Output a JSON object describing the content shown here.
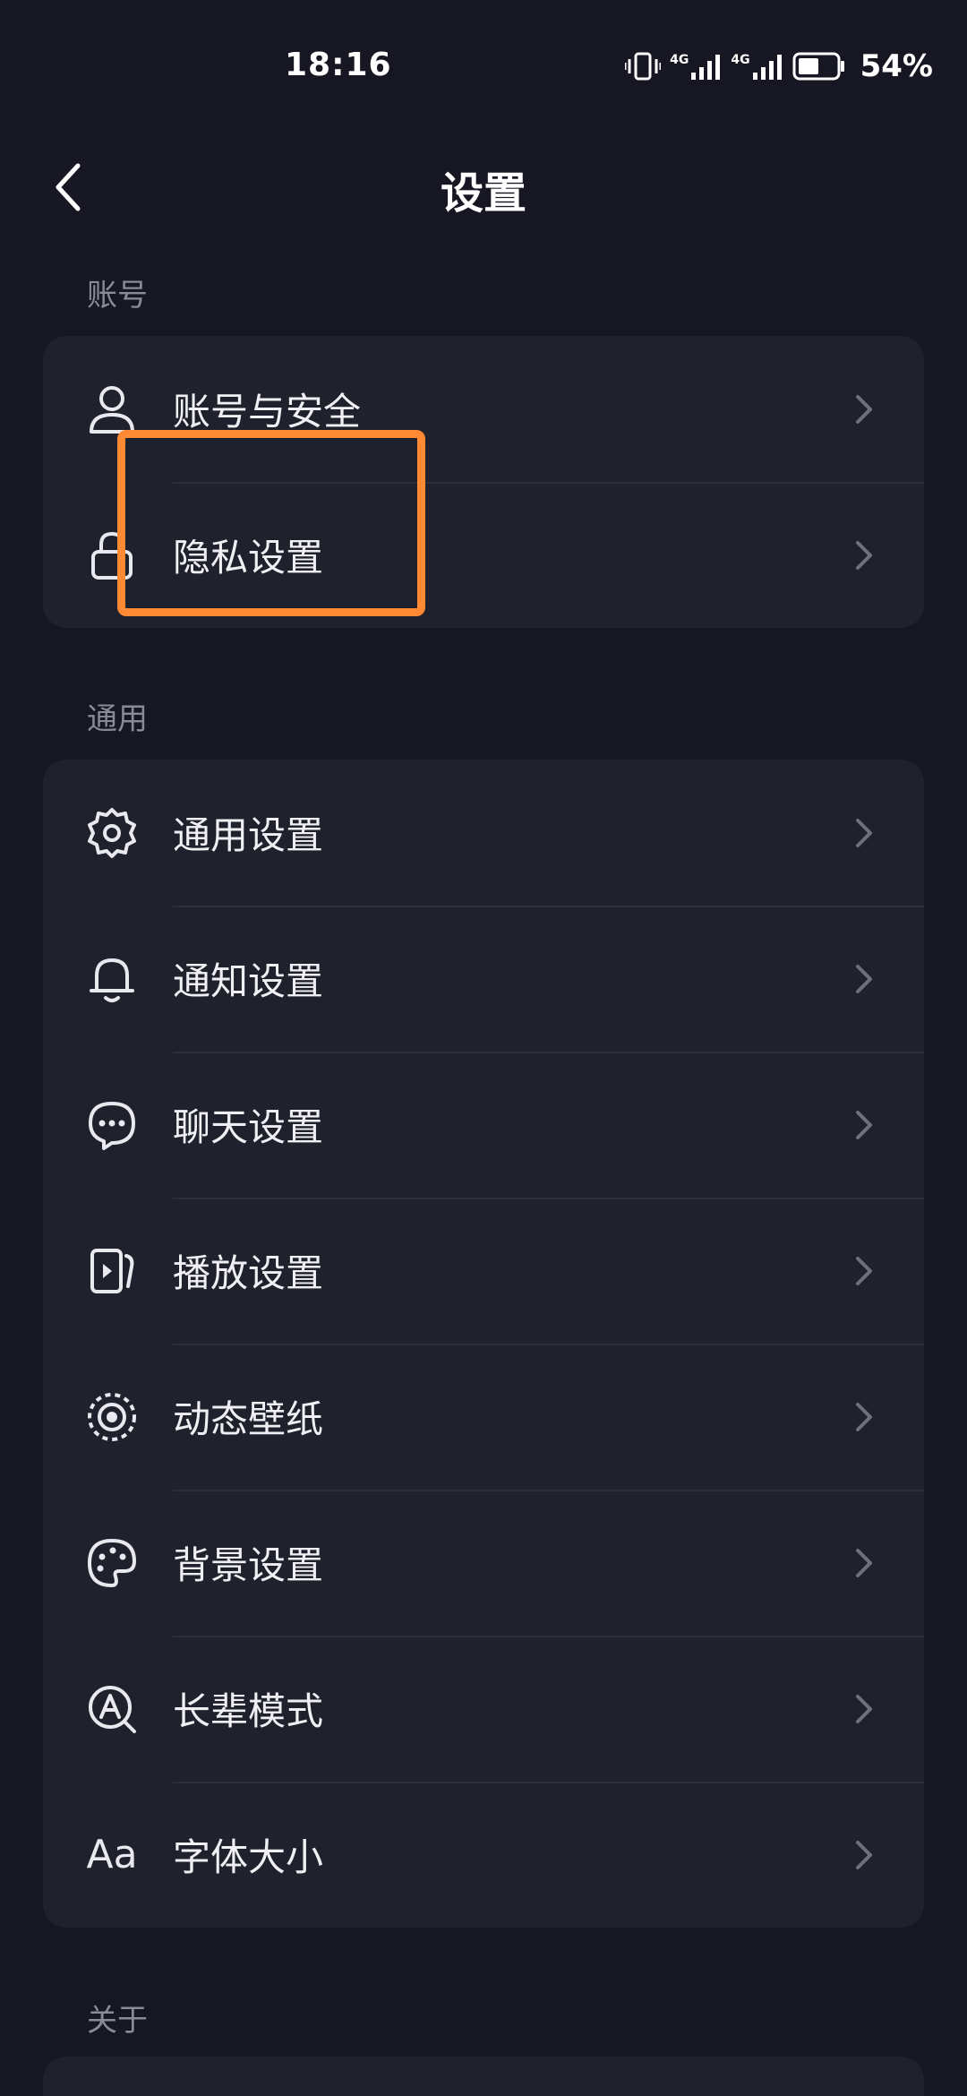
{
  "status_bar": {
    "time": "18:16",
    "network_1": "4G",
    "network_2": "4G",
    "battery_percent": "54%",
    "battery_level": 0.54
  },
  "header": {
    "title": "设置",
    "back_icon": "chevron-left-icon"
  },
  "sections": {
    "account": {
      "label": "账号",
      "items": [
        {
          "label": "账号与安全",
          "icon": "user-icon"
        },
        {
          "label": "隐私设置",
          "icon": "lock-icon"
        }
      ]
    },
    "general": {
      "label": "通用",
      "items": [
        {
          "label": "通用设置",
          "icon": "gear-icon"
        },
        {
          "label": "通知设置",
          "icon": "bell-icon"
        },
        {
          "label": "聊天设置",
          "icon": "chat-bubble-icon"
        },
        {
          "label": "播放设置",
          "icon": "play-icon"
        },
        {
          "label": "动态壁纸",
          "icon": "dynamic-wallpaper-icon"
        },
        {
          "label": "背景设置",
          "icon": "palette-icon"
        },
        {
          "label": "长辈模式",
          "icon": "elder-mode-icon"
        },
        {
          "label": "字体大小",
          "icon": "font-size-icon",
          "icon_text": "Aa"
        }
      ]
    },
    "about": {
      "label": "关于"
    }
  },
  "colors": {
    "background": "#161722",
    "card": "#1f212c",
    "highlight": "#ff8a33",
    "section_label": "#8a8b96"
  }
}
